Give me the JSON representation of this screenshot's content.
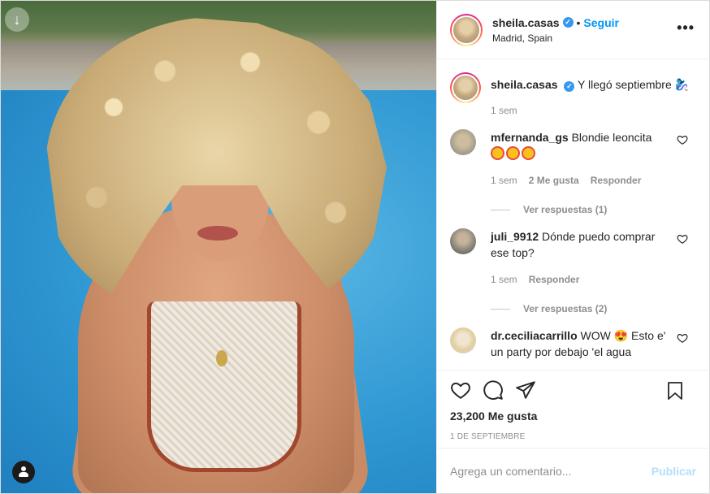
{
  "post": {
    "username": "sheila.casas",
    "follow_label": "Seguir",
    "separator": "•",
    "location": "Madrid, Spain",
    "more_label": "•••",
    "verified_mark": "✓"
  },
  "caption": {
    "username": "sheila.casas",
    "text": "Y llegó septiembre 🧞‍♀️",
    "time": "1 sem"
  },
  "comments": [
    {
      "username": "mfernanda_gs",
      "text": "Blondie leoncita",
      "emojis": "😍😍😍",
      "time": "1 sem",
      "likes": "2 Me gusta",
      "reply_label": "Responder",
      "view_replies": "Ver respuestas (1)"
    },
    {
      "username": "juli_9912",
      "text": "Dónde puedo comprar ese top?",
      "time": "1 sem",
      "reply_label": "Responder",
      "view_replies": "Ver respuestas (2)"
    },
    {
      "username": "dr.ceciliacarrillo",
      "text": "WOW 😍 Esto e' un party por debajo 'el agua"
    }
  ],
  "footer": {
    "likes": "23,200 Me gusta",
    "date": "1 DE SEPTIEMBRE",
    "comment_placeholder": "Agrega un comentario...",
    "publish_label": "Publicar"
  },
  "icons": {
    "download": "download-icon",
    "tag": "user-tag-icon",
    "like": "heart-icon",
    "comment": "comment-icon",
    "share": "share-icon",
    "save": "bookmark-icon"
  },
  "colors": {
    "accent": "#0095f6",
    "verified": "#3897f0",
    "muted": "#8e8e8e",
    "publish_disabled": "#b2dffc"
  }
}
